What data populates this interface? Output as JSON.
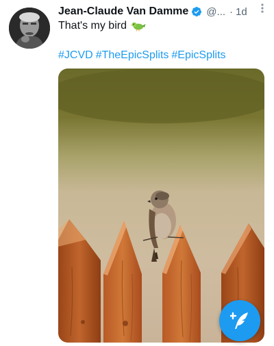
{
  "tweet": {
    "author_name": "Jean-Claude Van Damme",
    "handle": "@...",
    "separator": "·",
    "time": "1d",
    "more_icon": "more-vertical-icon",
    "text": "That's my bird",
    "emoji_icon": "bird-emoji-icon",
    "hashtags": [
      "#JCVD",
      "#TheEpicSplits",
      "#EpicSplits"
    ],
    "media_description_icon": "sparrow-photo"
  },
  "colors": {
    "accent": "#1d9bf0",
    "text": "#0f1419",
    "secondary": "#536471"
  },
  "fab": {
    "icon": "compose-tweet-icon"
  }
}
